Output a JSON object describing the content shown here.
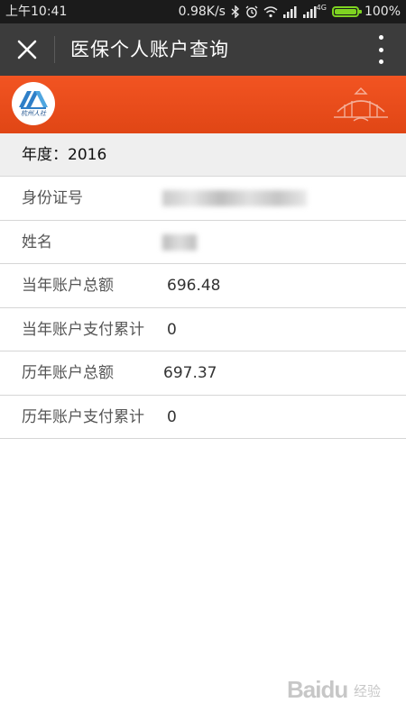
{
  "status_bar": {
    "time": "上午10:41",
    "net_speed": "0.98K/s",
    "signal_label": "4G",
    "battery": "100%",
    "battery_level": 1.0,
    "icons": [
      "bluetooth-icon",
      "alarm-icon",
      "wifi-icon",
      "signal-icon",
      "signal-4g-icon",
      "battery-icon"
    ]
  },
  "title_bar": {
    "title": "医保个人账户查询",
    "close_icon": "close-icon",
    "more_icon": "more-vertical-icon"
  },
  "banner": {
    "logo_text": "杭州人社",
    "background": "#e8501c"
  },
  "year": {
    "label": "年度：2016"
  },
  "rows": [
    {
      "label": "身份证号",
      "value": ""
    },
    {
      "label": "姓名",
      "value": ""
    },
    {
      "label": "当年账户总额",
      "value": "696.48"
    },
    {
      "label": "当年账户支付累计",
      "value": "0"
    },
    {
      "label": "历年账户总额",
      "value": "697.37"
    },
    {
      "label": "历年账户支付累计",
      "value": "0"
    }
  ],
  "watermark": {
    "text": "Baidu",
    "subtext": "经验"
  },
  "colors": {
    "status_bar": "#1b1b1b",
    "title_bar": "#3c3c3c",
    "banner": "#e8501c",
    "year_row": "#efefef",
    "battery": "#7ed321"
  }
}
